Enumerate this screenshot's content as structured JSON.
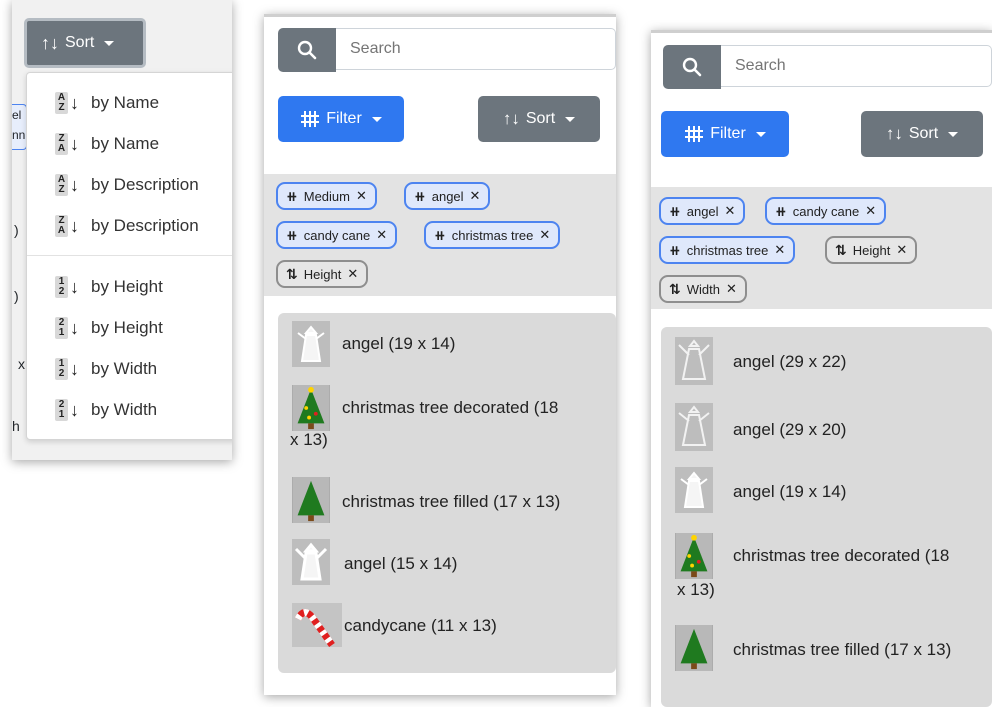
{
  "panel1": {
    "sort_label": "Sort",
    "menu_items": [
      {
        "label": "by Name",
        "top": "A",
        "bottom": "Z"
      },
      {
        "label": "by Name",
        "top": "Z",
        "bottom": "A"
      },
      {
        "label": "by Description",
        "top": "A",
        "bottom": "Z"
      },
      {
        "label": "by Description",
        "top": "Z",
        "bottom": "A"
      },
      {
        "label": "by Height",
        "top": "1",
        "bottom": "2"
      },
      {
        "label": "by Height",
        "top": "2",
        "bottom": "1"
      },
      {
        "label": "by Width",
        "top": "1",
        "bottom": "2"
      },
      {
        "label": "by Width",
        "top": "2",
        "bottom": "1"
      }
    ],
    "edge_text": [
      "el",
      "nn",
      ")",
      ")",
      "x",
      "h"
    ]
  },
  "panel2": {
    "search_placeholder": "Search",
    "filter_label": "Filter",
    "sort_label": "Sort",
    "tags": [
      {
        "label": "Medium",
        "kind": "filter"
      },
      {
        "label": "angel",
        "kind": "filter"
      },
      {
        "label": "candy cane",
        "kind": "filter"
      },
      {
        "label": "christmas tree",
        "kind": "filter"
      },
      {
        "label": "Height",
        "kind": "sort"
      }
    ],
    "results": [
      {
        "line1": "angel (19 x 14)",
        "line2": "",
        "icon": "angel-icon"
      },
      {
        "line1": "christmas tree decorated (18",
        "line2": "x 13)",
        "icon": "decorated-tree-icon"
      },
      {
        "line1": "christmas tree filled (17 x 13)",
        "line2": "",
        "icon": "tree-icon"
      },
      {
        "line1": "angel (15 x 14)",
        "line2": "",
        "icon": "angel-icon"
      },
      {
        "line1": "candycane (11 x 13)",
        "line2": "",
        "icon": "candycane-icon"
      }
    ]
  },
  "panel3": {
    "search_placeholder": "Search",
    "filter_label": "Filter",
    "sort_label": "Sort",
    "tags": [
      {
        "label": "angel",
        "kind": "filter"
      },
      {
        "label": "candy cane",
        "kind": "filter"
      },
      {
        "label": "christmas tree",
        "kind": "filter"
      },
      {
        "label": "Height",
        "kind": "sort"
      },
      {
        "label": "Width",
        "kind": "sort"
      }
    ],
    "results": [
      {
        "line1": "angel (29 x 22)",
        "line2": "",
        "icon": "angel-icon"
      },
      {
        "line1": "angel (29 x 20)",
        "line2": "",
        "icon": "angel-icon"
      },
      {
        "line1": "angel (19 x 14)",
        "line2": "",
        "icon": "angel-icon"
      },
      {
        "line1": "christmas tree decorated (18",
        "line2": "x 13)",
        "icon": "decorated-tree-icon"
      },
      {
        "line1": "christmas tree filled (17 x 13)",
        "line2": "",
        "icon": "tree-icon"
      }
    ]
  },
  "icons": {
    "search": "search-icon",
    "filter": "filter-icon",
    "sort": "sort-icon",
    "remove": "close-icon"
  },
  "colors": {
    "filter_blue": "#2f78f0",
    "sort_gray": "#6c757d",
    "tag_blue_border": "#4d84f0",
    "tag_gray_border": "#8e8e8e",
    "results_bg": "#dadada"
  }
}
